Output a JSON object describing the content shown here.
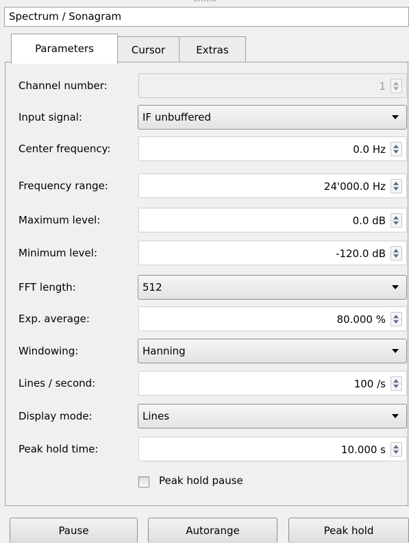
{
  "window": {
    "title": "Spectrum / Sonagram"
  },
  "tabs": [
    {
      "label": "Parameters",
      "active": true
    },
    {
      "label": "Cursor",
      "active": false
    },
    {
      "label": "Extras",
      "active": false
    }
  ],
  "fields": {
    "channel_number": {
      "label": "Channel number:",
      "value": "1",
      "enabled": false
    },
    "input_signal": {
      "label": "Input signal:",
      "value": "IF unbuffered"
    },
    "center_frequency": {
      "label": "Center frequency:",
      "value": "0.0 Hz"
    },
    "frequency_range": {
      "label": "Frequency range:",
      "value": "24'000.0 Hz"
    },
    "maximum_level": {
      "label": "Maximum level:",
      "value": "0.0 dB"
    },
    "minimum_level": {
      "label": "Minimum level:",
      "value": "-120.0 dB"
    },
    "fft_length": {
      "label": "FFT length:",
      "value": "512"
    },
    "exp_average": {
      "label": "Exp. average:",
      "value": "80.000 %"
    },
    "windowing": {
      "label": "Windowing:",
      "value": "Hanning"
    },
    "lines_per_second": {
      "label": "Lines / second:",
      "value": "100 /s"
    },
    "display_mode": {
      "label": "Display mode:",
      "value": "Lines"
    },
    "peak_hold_time": {
      "label": "Peak hold time:",
      "value": "10.000 s"
    }
  },
  "peak_hold_pause": {
    "label": "Peak hold pause",
    "checked": false
  },
  "buttons": {
    "pause": "Pause",
    "autorange": "Autorange",
    "peak_hold": "Peak hold"
  },
  "colors": {
    "spin_arrow": "#5c6f8f",
    "border": "#a0a0a0",
    "background": "#f0f0f0"
  }
}
